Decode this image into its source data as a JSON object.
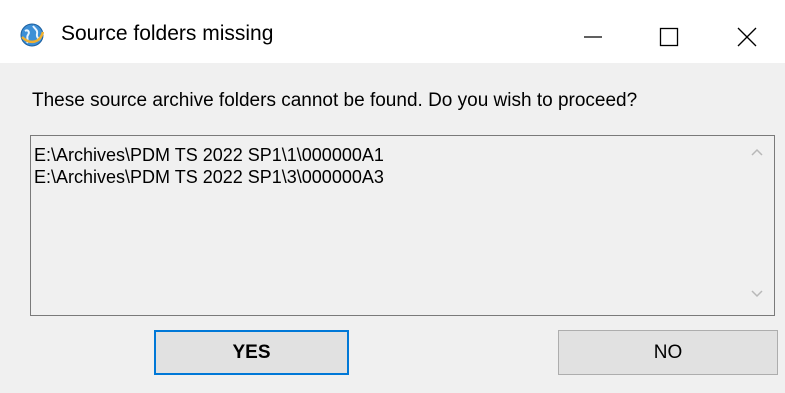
{
  "dialog": {
    "title": "Source folders missing",
    "message": "These source archive folders cannot be found. Do you wish to proceed?",
    "folders": [
      "E:\\Archives\\PDM TS 2022 SP1\\1\\000000A1",
      "E:\\Archives\\PDM TS 2022 SP1\\3\\000000A3"
    ],
    "yes_label": "YES",
    "no_label": "NO"
  },
  "icons": {
    "app": "globe-icon",
    "minimize": "minimize-icon",
    "maximize": "maximize-icon",
    "close": "close-icon",
    "scroll_up": "chevron-up-icon",
    "scroll_down": "chevron-down-icon"
  },
  "colors": {
    "default_button_border": "#0078d7",
    "button_face": "#e1e1e1",
    "window_background": "#f0f0f0"
  }
}
